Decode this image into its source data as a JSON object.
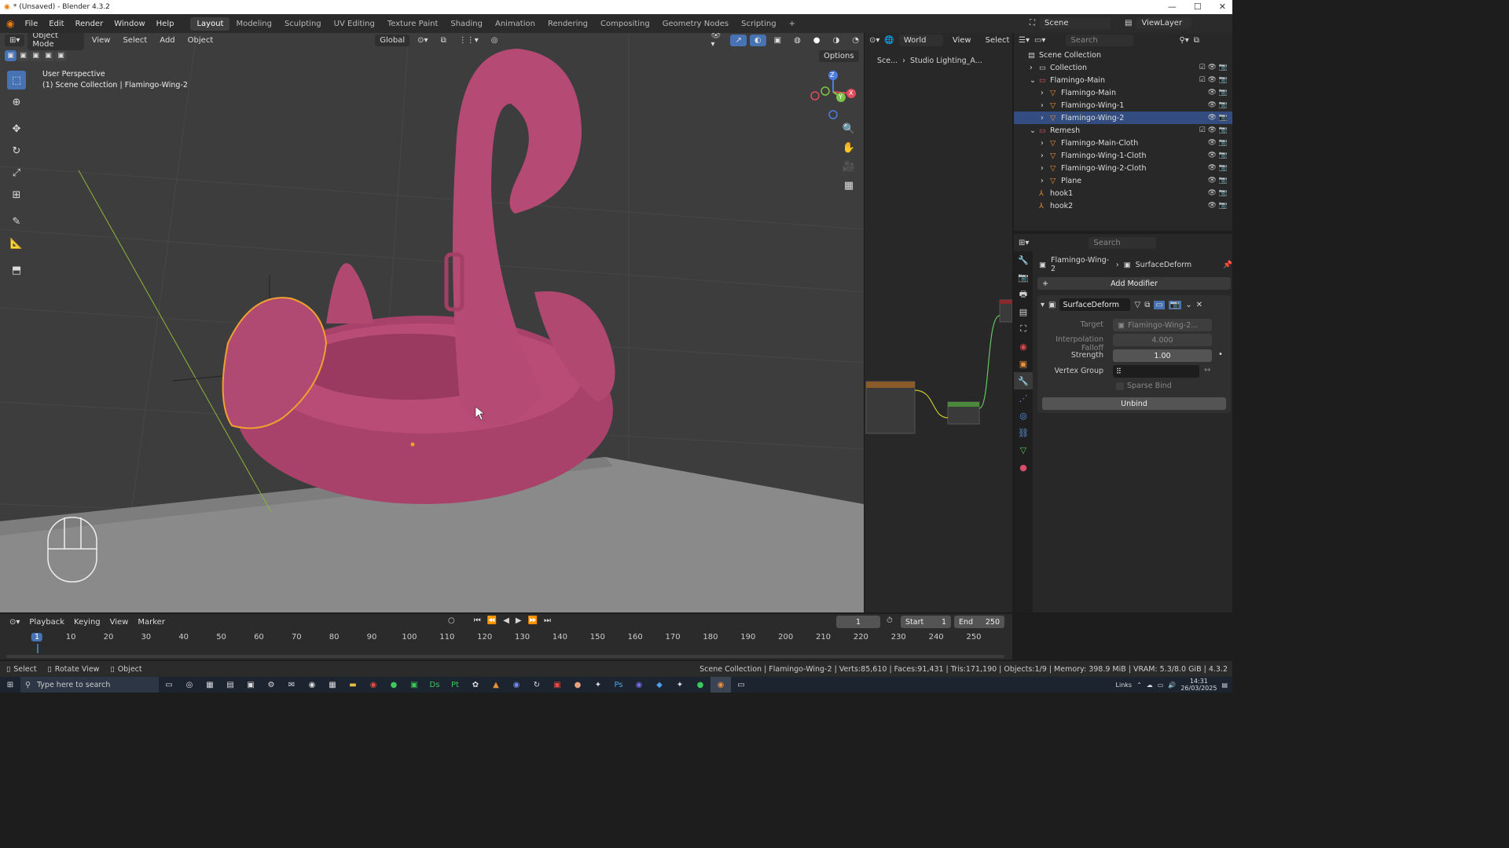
{
  "window": {
    "title": "* (Unsaved) - Blender 4.3.2",
    "controls": [
      "—",
      "☐",
      "✕"
    ]
  },
  "menu": [
    "File",
    "Edit",
    "Render",
    "Window",
    "Help"
  ],
  "workspaces": [
    "Layout",
    "Modeling",
    "Sculpting",
    "UV Editing",
    "Texture Paint",
    "Shading",
    "Animation",
    "Rendering",
    "Compositing",
    "Geometry Nodes",
    "Scripting"
  ],
  "active_workspace": "Layout",
  "scene": {
    "name": "Scene",
    "view_layer": "ViewLayer"
  },
  "viewport": {
    "mode": "Object Mode",
    "menus": [
      "View",
      "Select",
      "Add",
      "Object"
    ],
    "orientation": "Global",
    "options_label": "Options",
    "perspective_text": "User Perspective",
    "context_text": "(1) Scene Collection | Flamingo-Wing-2",
    "axis_labels": {
      "x": "X",
      "y": "Y",
      "z": "Z"
    },
    "colors": {
      "flamingo": "#b0466f",
      "selection": "#f0a030",
      "floor": "#8a8a8a",
      "background": "#3d3d3d"
    }
  },
  "node_editor": {
    "world_label": "World",
    "menus": [
      "View",
      "Select"
    ],
    "breadcrumb": [
      "Sce...",
      "Studio Lighting_A..."
    ]
  },
  "outliner": {
    "search_placeholder": "Search",
    "rows": [
      {
        "name": "Scene Collection",
        "type": "scene",
        "indent": 0
      },
      {
        "name": "Collection",
        "type": "collection",
        "indent": 1
      },
      {
        "name": "Flamingo-Main",
        "type": "collection",
        "indent": 1,
        "expanded": true
      },
      {
        "name": "Flamingo-Main",
        "type": "object",
        "indent": 2
      },
      {
        "name": "Flamingo-Wing-1",
        "type": "object",
        "indent": 2
      },
      {
        "name": "Flamingo-Wing-2",
        "type": "object",
        "indent": 2,
        "selected": true
      },
      {
        "name": "Remesh",
        "type": "collection",
        "indent": 1,
        "expanded": true
      },
      {
        "name": "Flamingo-Main-Cloth",
        "type": "object",
        "indent": 2
      },
      {
        "name": "Flamingo-Wing-1-Cloth",
        "type": "object",
        "indent": 2
      },
      {
        "name": "Flamingo-Wing-2-Cloth",
        "type": "object",
        "indent": 2
      },
      {
        "name": "Plane",
        "type": "object",
        "indent": 2
      },
      {
        "name": "hook1",
        "type": "empty",
        "indent": 1
      },
      {
        "name": "hook2",
        "type": "empty",
        "indent": 1
      }
    ]
  },
  "properties": {
    "search_placeholder": "Search",
    "breadcrumb_object": "Flamingo-Wing-2",
    "breadcrumb_modifier": "SurfaceDeform",
    "add_modifier_label": "Add Modifier",
    "modifier": {
      "name": "SurfaceDeform",
      "target_label": "Target",
      "target_value": "Flamingo-Wing-2...",
      "falloff_label": "Interpolation Falloff",
      "falloff_value": "4.000",
      "strength_label": "Strength",
      "strength_value": "1.00",
      "vgroup_label": "Vertex Group",
      "sparse_label": "Sparse Bind",
      "unbind_label": "Unbind"
    }
  },
  "timeline": {
    "menus": [
      "Playback",
      "Keying",
      "View",
      "Marker"
    ],
    "current_frame": "1",
    "start_label": "Start",
    "start_value": "1",
    "end_label": "End",
    "end_value": "250",
    "frame_labels": [
      "1",
      "10",
      "20",
      "30",
      "40",
      "50",
      "60",
      "70",
      "80",
      "90",
      "100",
      "110",
      "120",
      "130",
      "140",
      "150",
      "160",
      "170",
      "180",
      "190",
      "200",
      "210",
      "220",
      "230",
      "240",
      "250"
    ]
  },
  "statusbar": {
    "hints": [
      "Select",
      "Rotate View",
      "Object"
    ],
    "info": "Scene Collection | Flamingo-Wing-2 | Verts:85,610 | Faces:91,431 | Tris:171,190 | Objects:1/9 | Memory: 398.9 MiB | VRAM: 5.3/8.0 GiB | 4.3.2"
  },
  "taskbar": {
    "search_placeholder": "Type here to search",
    "links_label": "Links",
    "time": "14:31",
    "date": "26/03/2025"
  }
}
